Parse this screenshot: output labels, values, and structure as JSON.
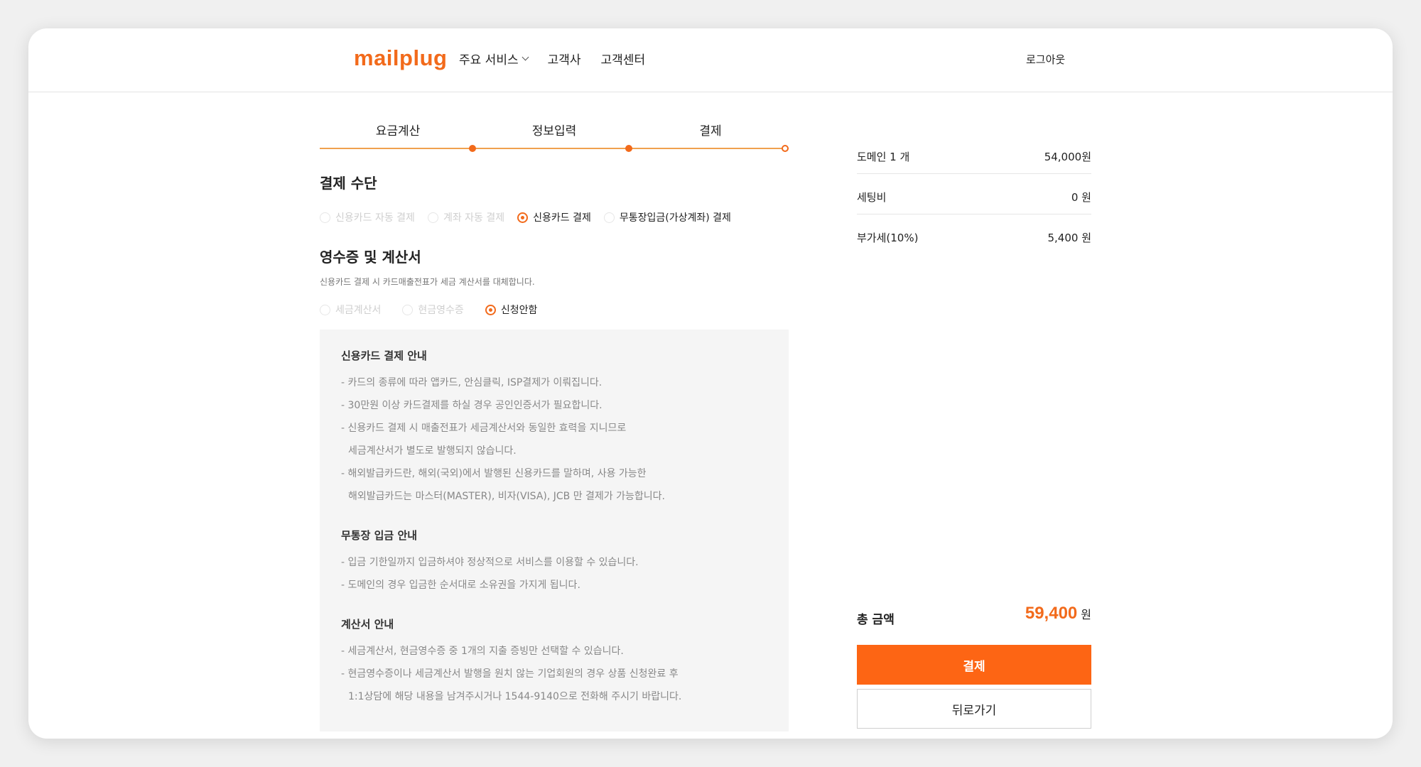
{
  "header": {
    "logo": "mailplug",
    "nav": [
      "주요 서비스",
      "고객사",
      "고객센터"
    ],
    "logout": "로그아웃"
  },
  "steps": [
    "요금계산",
    "정보입력",
    "결제"
  ],
  "payment": {
    "title": "결제 수단",
    "options": [
      "신용카드 자동 결제",
      "계좌 자동 결제",
      "신용카드 결제",
      "무통장입금(가상계좌) 결제"
    ],
    "selected": "신용카드 결제"
  },
  "receipt": {
    "title": "영수증 및 계산서",
    "desc": "신용카드 결제 시 카드매출전표가 세금 계산서를 대체합니다.",
    "options": [
      "세금계산서",
      "현금영수증",
      "신청안함"
    ],
    "selected": "신청안함"
  },
  "info": {
    "card": {
      "head": "신용카드 결제 안내",
      "lines": [
        "- 카드의 종류에 따라 앱카드, 안심클릭, ISP결제가 이뤄집니다.",
        "- 30만원 이상 카드결제를 하실 경우 공인인증서가 필요합니다.",
        "- 신용카드 결제 시 매출전표가 세금계산서와 동일한 효력을 지니므로",
        "세금계산서가 별도로 발행되지 않습니다.",
        "- 해외발급카드란, 해외(국외)에서 발행된 신용카드를 말하며, 사용 가능한",
        "해외발급카드는 마스터(MASTER), 비자(VISA), JCB 만 결제가 가능합니다."
      ]
    },
    "bank": {
      "head": "무통장 입금 안내",
      "lines": [
        "- 입금 기한일까지 입금하셔야 정상적으로 서비스를 이용할 수 있습니다.",
        "- 도메인의 경우 입금한 순서대로 소유권을 가지게 됩니다."
      ]
    },
    "invoice": {
      "head": "계산서 안내",
      "lines": [
        "- 세금계산서, 현금영수증 중 1개의 지출 증빙만 선택할 수 있습니다.",
        "- 현금영수증이나 세금계산서 발행을 원치 않는 기업회원의 경우 상품 신청완료 후",
        "1:1상담에 해당 내용을 남겨주시거나 1544-9140으로 전화해 주시기 바랍니다."
      ]
    }
  },
  "summary": {
    "rows": [
      {
        "label": "도메인 1 개",
        "value": "54,000원"
      },
      {
        "label": "세팅비",
        "value": "0 원"
      },
      {
        "label": "부가세(10%)",
        "value": "5,400 원"
      }
    ],
    "total_label": "총 금액",
    "total_value": "59,400",
    "total_unit": "원",
    "pay_button": "결제",
    "back_button": "뒤로가기"
  },
  "colors": {
    "accent": "#f26a1b",
    "pay_button": "#fd6514",
    "info_bg": "#f5f5f5"
  }
}
